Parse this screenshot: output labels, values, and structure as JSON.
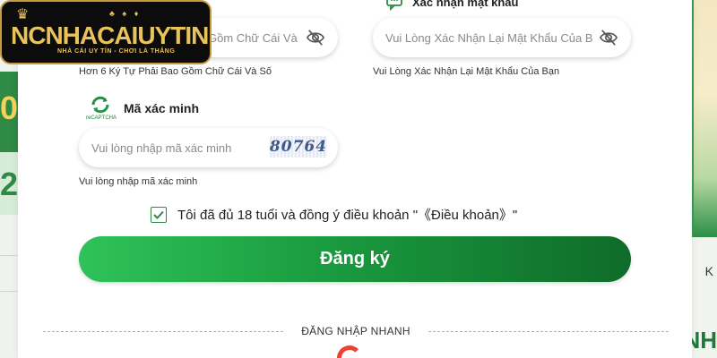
{
  "logo": {
    "brand": "NCNHACAIUYTIN",
    "tagline": "NHÀ CÁI UY TÍN - CHƠI LÀ THẮNG"
  },
  "background": {
    "left_digit_top": "0",
    "left_digit_bottom": "2",
    "right_letter": "K",
    "right_text": "NH"
  },
  "password": {
    "placeholder": "Gồm Chữ Cái Và",
    "helper": "Hơn 6 Ký Tự Phải Bao Gồm Chữ Cái Và Số",
    "icon": "eye-off-icon"
  },
  "confirm_password": {
    "label": "Xác nhận mật khẩu",
    "placeholder": "Vui Lòng Xác Nhận Lại Mật Khẩu Của Bạn",
    "helper": "Vui Lòng Xác Nhận Lại Mật Khẩu Của Bạn",
    "icon": "eye-off-icon"
  },
  "captcha": {
    "badge_text": "reCAPTCHA",
    "label": "Mã xác minh",
    "placeholder": "Vui lòng nhập mã xác minh",
    "code": "80764",
    "helper": "Vui lòng nhập mã xác minh"
  },
  "agreement": {
    "checked": true,
    "text": "Tôi đã đủ 18 tuổi và đồng ý điều khoản  \"《Điều khoản》\""
  },
  "submit": {
    "label": "Đăng ký"
  },
  "quick_login": {
    "label": "ĐĂNG NHẬP NHANH"
  },
  "colors": {
    "accent_green": "#1a9b3f",
    "dark_green": "#0f6b29",
    "logo_gold": "#e8c25a"
  }
}
